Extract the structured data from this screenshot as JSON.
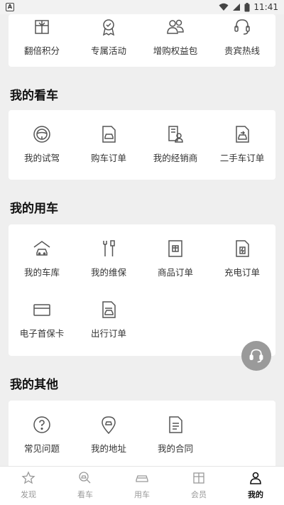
{
  "status_bar": {
    "notification_icon": "A",
    "time": "11:41"
  },
  "top_row": [
    {
      "label": "翻倍积分",
      "icon": "gift-box-icon"
    },
    {
      "label": "专属活动",
      "icon": "medal-icon"
    },
    {
      "label": "增购权益包",
      "icon": "people-icon"
    },
    {
      "label": "贵宾热线",
      "icon": "headset-icon"
    }
  ],
  "sections": {
    "view_car": {
      "title": "我的看车",
      "items": [
        {
          "label": "我的试驾",
          "icon": "steering-wheel-icon"
        },
        {
          "label": "购车订单",
          "icon": "car-document-icon"
        },
        {
          "label": "我的经销商",
          "icon": "dealer-icon"
        },
        {
          "label": "二手车订单",
          "icon": "used-car-document-icon"
        }
      ]
    },
    "use_car": {
      "title": "我的用车",
      "items": [
        {
          "label": "我的车库",
          "icon": "garage-icon"
        },
        {
          "label": "我的维保",
          "icon": "tools-icon"
        },
        {
          "label": "商品订单",
          "icon": "product-order-icon"
        },
        {
          "label": "充电订单",
          "icon": "charging-icon"
        },
        {
          "label": "电子首保卡",
          "icon": "card-icon"
        },
        {
          "label": "出行订单",
          "icon": "trip-order-icon"
        }
      ]
    },
    "other": {
      "title": "我的其他",
      "items": [
        {
          "label": "常见问题",
          "icon": "question-icon"
        },
        {
          "label": "我的地址",
          "icon": "location-icon"
        },
        {
          "label": "我的合同",
          "icon": "contract-icon"
        }
      ]
    }
  },
  "tabbar": [
    {
      "label": "发现",
      "icon": "star-icon",
      "active": false
    },
    {
      "label": "看车",
      "icon": "view-car-icon",
      "active": false
    },
    {
      "label": "用车",
      "icon": "car-icon",
      "active": false
    },
    {
      "label": "会员",
      "icon": "member-icon",
      "active": false
    },
    {
      "label": "我的",
      "icon": "user-icon",
      "active": true
    }
  ],
  "colors": {
    "background": "#efefef",
    "card": "#ffffff",
    "icon": "#555555",
    "active_tab": "#111111",
    "inactive_tab": "#999999",
    "float_button": "#9a9a9a"
  }
}
